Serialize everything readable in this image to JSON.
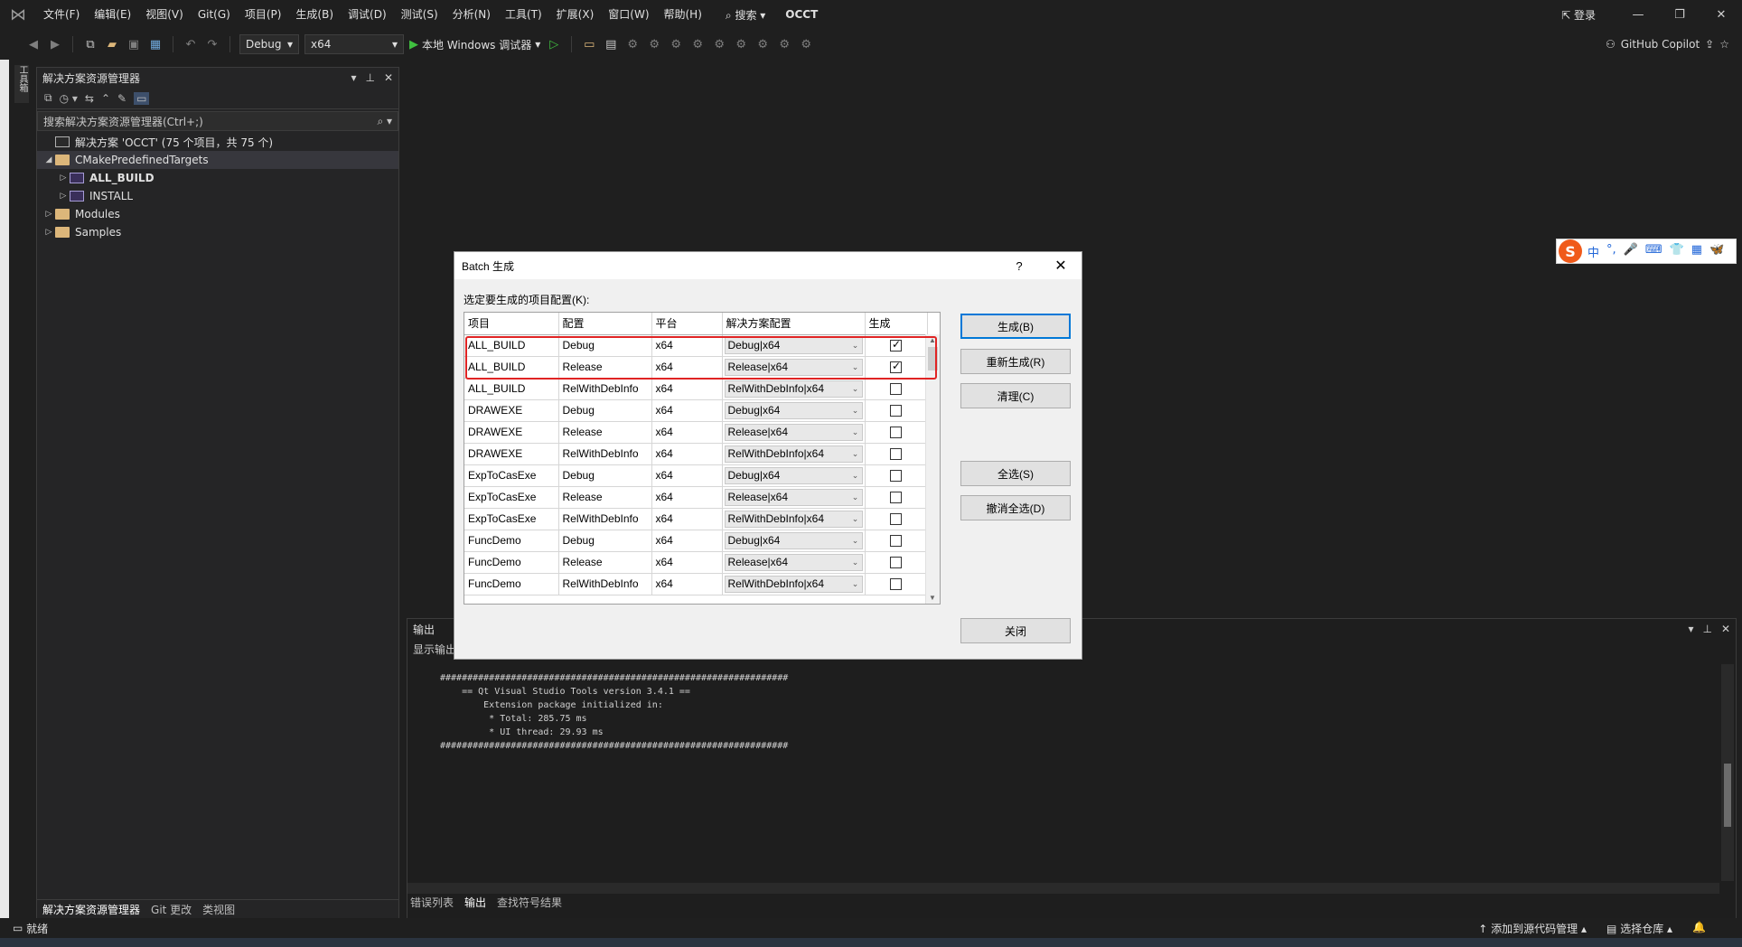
{
  "menubar": {
    "items": [
      "文件(F)",
      "编辑(E)",
      "视图(V)",
      "Git(G)",
      "项目(P)",
      "生成(B)",
      "调试(D)",
      "测试(S)",
      "分析(N)",
      "工具(T)",
      "扩展(X)",
      "窗口(W)",
      "帮助(H)"
    ],
    "search_label": "搜索",
    "project_name": "OCCT",
    "login_label": "登录"
  },
  "toolbar": {
    "config": "Debug",
    "platform": "x64",
    "run_label": "本地 Windows 调试器",
    "copilot_label": "GitHub Copilot"
  },
  "side_tab": "工具箱",
  "solution_explorer": {
    "title": "解决方案资源管理器",
    "search_placeholder": "搜索解决方案资源管理器(Ctrl+;)",
    "tree": [
      {
        "label": "解决方案 'OCCT' (75 个项目，共 75 个)",
        "level": 0,
        "icon": "solution"
      },
      {
        "label": "CMakePredefinedTargets",
        "level": 0,
        "icon": "folder",
        "expanded": true
      },
      {
        "label": "ALL_BUILD",
        "level": 1,
        "icon": "project",
        "bold": true
      },
      {
        "label": "INSTALL",
        "level": 1,
        "icon": "project"
      },
      {
        "label": "Modules",
        "level": 0,
        "icon": "folder"
      },
      {
        "label": "Samples",
        "level": 0,
        "icon": "folder"
      }
    ],
    "bottom_tabs": [
      "解决方案资源管理器",
      "Git 更改",
      "类视图"
    ]
  },
  "output": {
    "title": "输出",
    "show_from": "显示输出",
    "lines": [
      "################################################################",
      "    == Qt Visual Studio Tools version 3.4.1 ==",
      "        Extension package initialized in:",
      "         * Total: 285.75 ms",
      "         * UI thread: 29.93 ms",
      "################################################################"
    ],
    "bottom_tabs": [
      "错误列表",
      "输出",
      "查找符号结果"
    ]
  },
  "statusbar": {
    "ready": "就绪",
    "add_source": "添加到源代码管理",
    "select_repo": "选择仓库"
  },
  "ime": {
    "logo": "S",
    "items": [
      "中",
      "°,",
      "🎤",
      "⌨",
      "👕",
      "▦",
      "🦋"
    ]
  },
  "dialog": {
    "title": "Batch 生成",
    "help": "?",
    "prompt": "选定要生成的项目配置(K):",
    "columns": [
      "项目",
      "配置",
      "平台",
      "解决方案配置",
      "生成"
    ],
    "rows": [
      {
        "project": "ALL_BUILD",
        "config": "Debug",
        "platform": "x64",
        "solution_config": "Debug|x64",
        "build": true
      },
      {
        "project": "ALL_BUILD",
        "config": "Release",
        "platform": "x64",
        "solution_config": "Release|x64",
        "build": true
      },
      {
        "project": "ALL_BUILD",
        "config": "RelWithDebInfo",
        "platform": "x64",
        "solution_config": "RelWithDebInfo|x64",
        "build": false
      },
      {
        "project": "DRAWEXE",
        "config": "Debug",
        "platform": "x64",
        "solution_config": "Debug|x64",
        "build": false
      },
      {
        "project": "DRAWEXE",
        "config": "Release",
        "platform": "x64",
        "solution_config": "Release|x64",
        "build": false
      },
      {
        "project": "DRAWEXE",
        "config": "RelWithDebInfo",
        "platform": "x64",
        "solution_config": "RelWithDebInfo|x64",
        "build": false
      },
      {
        "project": "ExpToCasExe",
        "config": "Debug",
        "platform": "x64",
        "solution_config": "Debug|x64",
        "build": false
      },
      {
        "project": "ExpToCasExe",
        "config": "Release",
        "platform": "x64",
        "solution_config": "Release|x64",
        "build": false
      },
      {
        "project": "ExpToCasExe",
        "config": "RelWithDebInfo",
        "platform": "x64",
        "solution_config": "RelWithDebInfo|x64",
        "build": false
      },
      {
        "project": "FuncDemo",
        "config": "Debug",
        "platform": "x64",
        "solution_config": "Debug|x64",
        "build": false
      },
      {
        "project": "FuncDemo",
        "config": "Release",
        "platform": "x64",
        "solution_config": "Release|x64",
        "build": false
      },
      {
        "project": "FuncDemo",
        "config": "RelWithDebInfo",
        "platform": "x64",
        "solution_config": "RelWithDebInfo|x64",
        "build": false
      }
    ],
    "buttons": {
      "build": "生成(B)",
      "rebuild": "重新生成(R)",
      "clean": "清理(C)",
      "select_all": "全选(S)",
      "deselect_all": "撤消全选(D)",
      "close": "关闭"
    }
  }
}
